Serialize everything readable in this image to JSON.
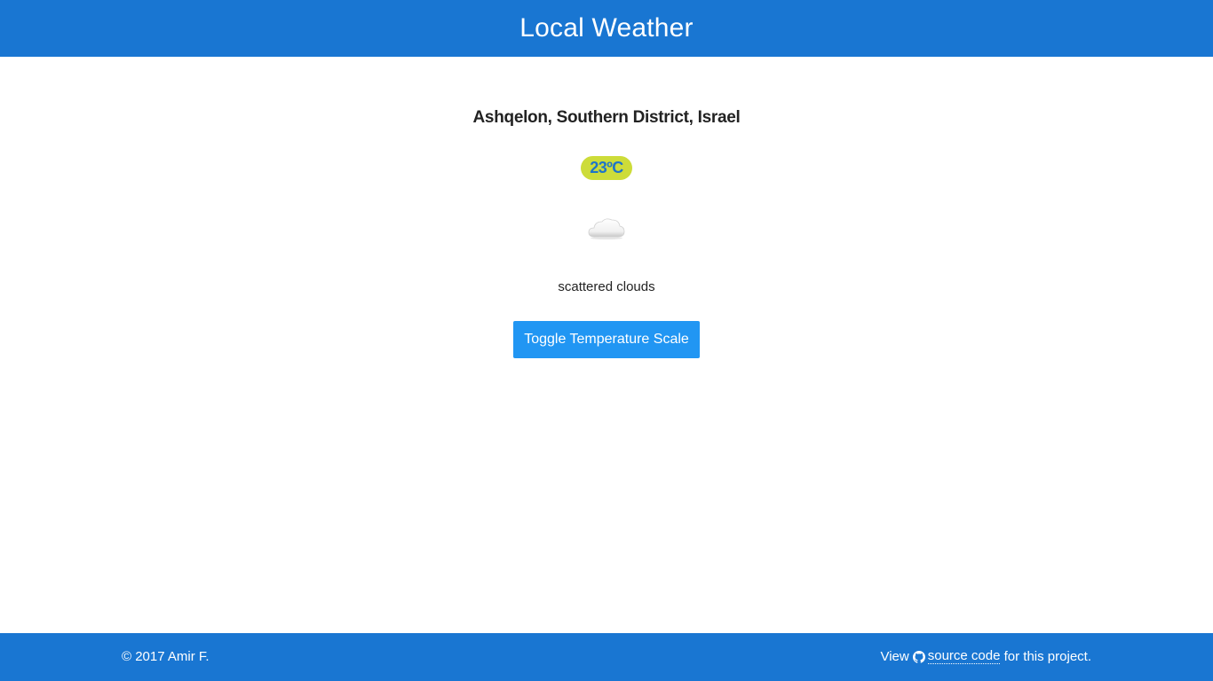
{
  "header": {
    "title": "Local Weather"
  },
  "weather": {
    "location": "Ashqelon, Southern District, Israel",
    "temperature": "23ºC",
    "icon": "cloud-icon",
    "description": "scattered clouds"
  },
  "actions": {
    "toggle_label": "Toggle Temperature Scale"
  },
  "footer": {
    "copyright": "© 2017 Amir F.",
    "view_text": "View",
    "source_link_label": "source code",
    "suffix_text": "for this project.",
    "link_icon": "github-icon"
  },
  "colors": {
    "header_bg": "#1976d2",
    "badge_bg": "#cddc39",
    "badge_text": "#1e74c9",
    "button_bg": "#2196f3"
  }
}
